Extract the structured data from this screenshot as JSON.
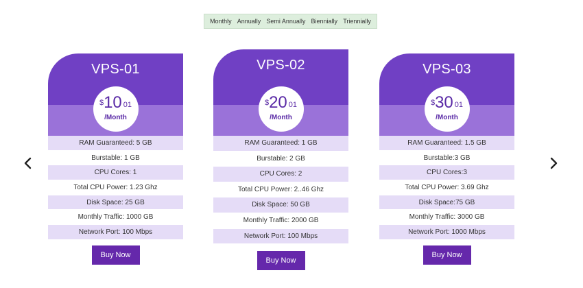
{
  "billing_cycles": [
    "Monthly",
    "Annually",
    "Semi Annually",
    "Biennially",
    "Triennially"
  ],
  "colors": {
    "header": "#7040c4",
    "header_band": "#9a72d9",
    "row_alt": "#e5dcf7",
    "button": "#6528ab",
    "tab_bg": "#ddeedd"
  },
  "nav": {
    "prev_icon": "chevron-left-icon",
    "next_icon": "chevron-right-icon"
  },
  "plans": [
    {
      "name": "VPS-01",
      "currency": "$",
      "amount": "10",
      "cents": "01",
      "period": "/Month",
      "features": [
        "RAM Guaranteed: 5 GB",
        "Burstable: 1 GB",
        "CPU Cores: 1",
        "Total CPU Power: 1.23 Ghz",
        "Disk Space: 25 GB",
        "Monthly Traffic: 1000 GB",
        "Network Port: 100 Mbps"
      ],
      "button": "Buy Now"
    },
    {
      "name": "VPS-02",
      "currency": "$",
      "amount": "20",
      "cents": "01",
      "period": "/Month",
      "features": [
        "RAM Guaranteed: 1 GB",
        "Burstable: 2 GB",
        "CPU Cores: 2",
        "Total CPU Power: 2..46 Ghz",
        "Disk Space: 50 GB",
        "Monthly Traffic: 2000 GB",
        "Network Port: 100 Mbps"
      ],
      "button": "Buy Now"
    },
    {
      "name": "VPS-03",
      "currency": "$",
      "amount": "30",
      "cents": "01",
      "period": "/Month",
      "features": [
        "RAM Guaranteed: 1.5 GB",
        "Burstable:3 GB",
        "CPU Cores:3",
        "Total CPU Power: 3.69 Ghz",
        "Disk Space:75 GB",
        "Monthly Traffic: 3000 GB",
        "Network Port: 1000 Mbps"
      ],
      "button": "Buy Now"
    }
  ]
}
